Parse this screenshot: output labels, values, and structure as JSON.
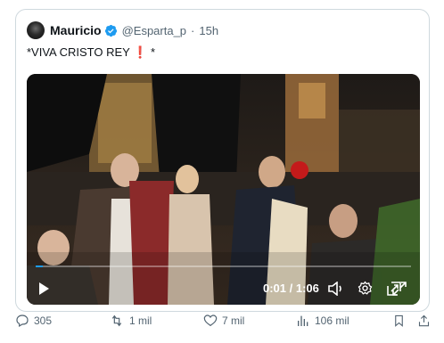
{
  "tweet": {
    "author_name": "Mauricio",
    "handle": "@Esparta_p",
    "separator": "·",
    "time": "15h",
    "text_before": "*VIVA CRISTO REY ",
    "text_emoji": "❗",
    "text_after": " *"
  },
  "video": {
    "current_time": "0:01",
    "duration": "1:06",
    "time_separator": " / ",
    "progress_fraction": 0.015
  },
  "actions": {
    "replies": "305",
    "retweets": "1 mil",
    "likes": "7 mil",
    "views": "106 mil"
  },
  "colors": {
    "accent": "#1d9bf0",
    "text_secondary": "#536471",
    "border": "#cfd9de"
  }
}
